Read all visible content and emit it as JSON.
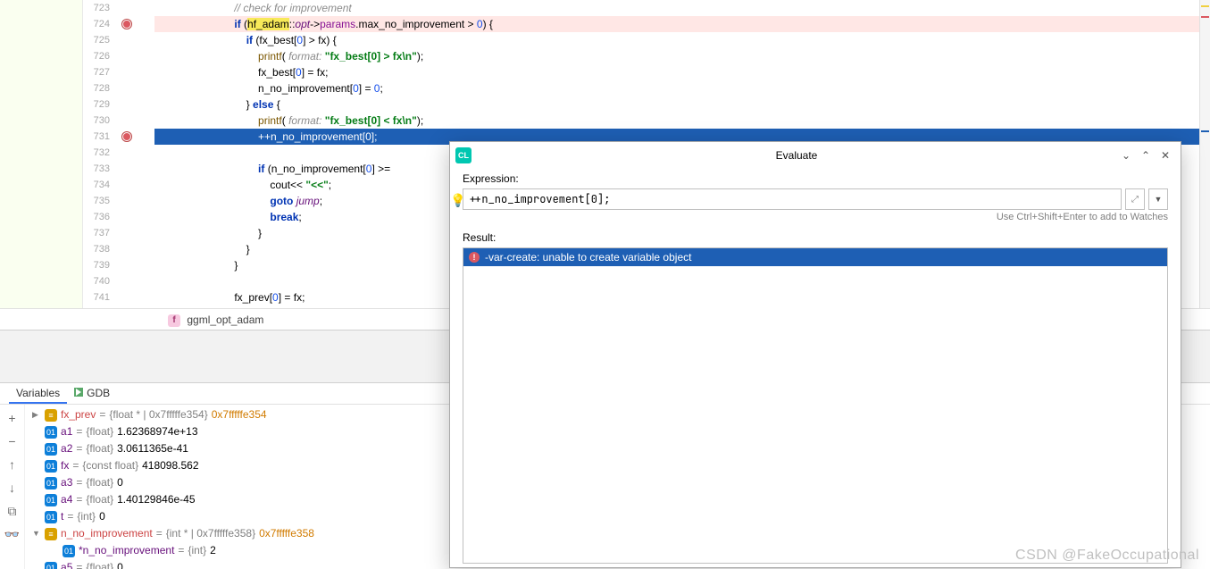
{
  "code": {
    "lines": [
      {
        "num": "723",
        "marks": [],
        "cls": "",
        "html": "                         <span class='cmt'>// check for improvement</span>"
      },
      {
        "num": "724",
        "marks": [
          "bp"
        ],
        "cls": "hl-bp",
        "html": "                         <span class='kw'>if</span> (<span class='yellow-hl'>hf_adam</span>::<span class='purple-id'>opt</span>-><span class='id'>params</span>.max_no_improvement > <span class='num'>0</span>) {"
      },
      {
        "num": "725",
        "marks": [],
        "cls": "",
        "html": "                             <span class='kw'>if</span> (fx_best[<span class='num'>0</span>] > fx) {"
      },
      {
        "num": "726",
        "marks": [],
        "cls": "",
        "html": "                                 <span class='fn'>printf</span>( <span class='cmt'>format:</span> <span class='str'>\"fx_best[0] > fx\\n\"</span>);"
      },
      {
        "num": "727",
        "marks": [],
        "cls": "",
        "html": "                                 fx_best[<span class='num'>0</span>] = fx;"
      },
      {
        "num": "728",
        "marks": [],
        "cls": "",
        "html": "                                 n_no_improvement[<span class='num'>0</span>] = <span class='num'>0</span>;"
      },
      {
        "num": "729",
        "marks": [],
        "cls": "",
        "html": "                             } <span class='kw'>else</span> {"
      },
      {
        "num": "730",
        "marks": [],
        "cls": "",
        "html": "                                 <span class='fn'>printf</span>( <span class='cmt'>format:</span> <span class='str'>\"fx_best[0] < fx\\n\"</span>);"
      },
      {
        "num": "731",
        "marks": [
          "bp"
        ],
        "cls": "exec",
        "html": "                                 ++n_no_improvement[<span class='num'>0</span>];"
      },
      {
        "num": "732",
        "marks": [],
        "cls": "",
        "html": ""
      },
      {
        "num": "733",
        "marks": [],
        "cls": "",
        "html": "                                 <span class='kw'>if</span> (n_no_improvement[<span class='num'>0</span>] >="
      },
      {
        "num": "734",
        "marks": [],
        "cls": "",
        "html": "                                     cout<< <span class='str'>\"<<\"</span>;"
      },
      {
        "num": "735",
        "marks": [],
        "cls": "",
        "html": "                                     <span class='kw'>goto</span> <span class='purple-id'>jump</span>;"
      },
      {
        "num": "736",
        "marks": [],
        "cls": "",
        "html": "                                     <span class='kw'>break</span>;"
      },
      {
        "num": "737",
        "marks": [],
        "cls": "",
        "html": "                                 }"
      },
      {
        "num": "738",
        "marks": [],
        "cls": "",
        "html": "                             }"
      },
      {
        "num": "739",
        "marks": [],
        "cls": "",
        "html": "                         }"
      },
      {
        "num": "740",
        "marks": [],
        "cls": "",
        "html": ""
      },
      {
        "num": "741",
        "marks": [],
        "cls": "",
        "html": "                         fx_prev[<span class='num'>0</span>] = fx;"
      }
    ]
  },
  "breadcrumb": {
    "fn": "ggml_opt_adam",
    "badge": "f"
  },
  "debug": {
    "tabs": {
      "variables": "Variables",
      "gdb": "GDB"
    },
    "vars": [
      {
        "indent": 0,
        "arrow": "▶",
        "badge": "≡",
        "bcls": "vb-yellow",
        "name": "fx_prev",
        "namecls": "red",
        "type": "{float * | 0x7fffffe354}",
        "val": "0x7fffffe354",
        "ptr": true
      },
      {
        "indent": 0,
        "arrow": "",
        "badge": "01",
        "bcls": "vb-blue",
        "name": "a1",
        "namecls": "",
        "type": "{float}",
        "val": "1.62368974e+13"
      },
      {
        "indent": 0,
        "arrow": "",
        "badge": "01",
        "bcls": "vb-blue",
        "name": "a2",
        "namecls": "",
        "type": "{float}",
        "val": "3.0611365e-41"
      },
      {
        "indent": 0,
        "arrow": "",
        "badge": "01",
        "bcls": "vb-blue",
        "name": "fx",
        "namecls": "",
        "type": "{const float}",
        "val": "418098.562"
      },
      {
        "indent": 0,
        "arrow": "",
        "badge": "01",
        "bcls": "vb-blue",
        "name": "a3",
        "namecls": "",
        "type": "{float}",
        "val": "0"
      },
      {
        "indent": 0,
        "arrow": "",
        "badge": "01",
        "bcls": "vb-blue",
        "name": "a4",
        "namecls": "",
        "type": "{float}",
        "val": "1.40129846e-45"
      },
      {
        "indent": 0,
        "arrow": "",
        "badge": "01",
        "bcls": "vb-blue",
        "name": "t",
        "namecls": "",
        "type": "{int}",
        "val": "0"
      },
      {
        "indent": 0,
        "arrow": "▼",
        "badge": "≡",
        "bcls": "vb-yellow",
        "name": "n_no_improvement",
        "namecls": "red",
        "type": "{int * | 0x7fffffe358}",
        "val": "0x7fffffe358",
        "ptr": true
      },
      {
        "indent": 1,
        "arrow": "",
        "badge": "01",
        "bcls": "vb-blue",
        "name": "*n_no_improvement",
        "namecls": "",
        "type": "{int}",
        "val": "2"
      },
      {
        "indent": 0,
        "arrow": "",
        "badge": "01",
        "bcls": "vb-blue",
        "name": "a5",
        "namecls": "",
        "type": "{float}",
        "val": "0"
      }
    ]
  },
  "evaluate": {
    "title": "Evaluate",
    "app_icon_label": "CL",
    "expr_label": "Expression:",
    "expr_value": "++n_no_improvement[0];",
    "hint": "Use Ctrl+Shift+Enter to add to Watches",
    "result_label": "Result:",
    "result_error": "-var-create: unable to create variable object"
  },
  "watermark": "CSDN @FakeOccupational"
}
